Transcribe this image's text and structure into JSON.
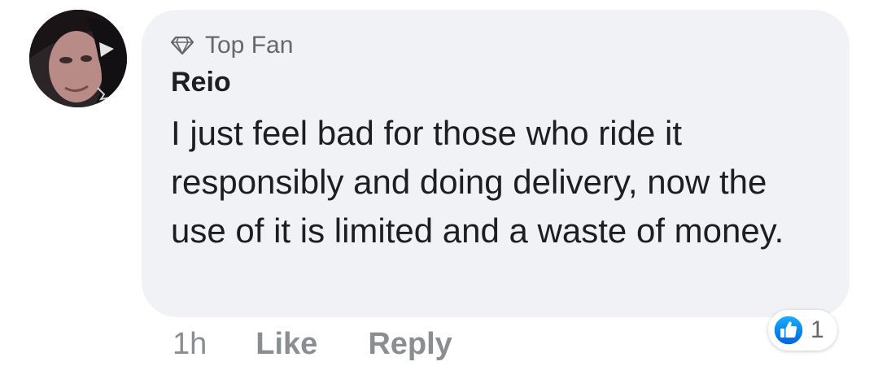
{
  "comment": {
    "badge": "Top Fan",
    "author": "Reio",
    "text": "I just feel bad for those who ride it responsibly and doing delivery, now the use of it is limited and a waste of money.",
    "timestamp": "1h",
    "like_label": "Like",
    "reply_label": "Reply",
    "reaction_count": "1",
    "reaction_icon": "thumbs-up-icon",
    "badge_icon": "diamond-icon",
    "colors": {
      "bubble": "#f0f2f5",
      "primary_text": "#1c1e21",
      "secondary_text": "#65676b",
      "action_text": "#8a8d91",
      "like_blue": "#1877f2"
    }
  }
}
